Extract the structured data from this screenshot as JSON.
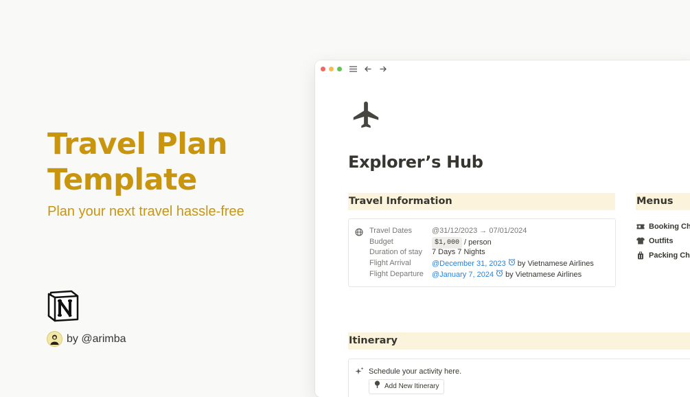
{
  "hero": {
    "title_line1": "Travel Plan",
    "title_line2": "Template",
    "subtitle": "Plan your next travel hassle-free",
    "author": "by @arimba",
    "accent_color": "#c9950c"
  },
  "window": {
    "controls": {
      "close": "#ee6a5f",
      "minimize": "#f5bd4f",
      "maximize": "#61c454"
    },
    "toolbar_icons": [
      "menu-icon",
      "back-arrow-icon",
      "forward-arrow-icon"
    ],
    "page_icon": "airplane-icon",
    "page_title": "Explorer’s Hub"
  },
  "travel_info": {
    "heading": "Travel Information",
    "properties": [
      {
        "label": "Travel Dates",
        "value": "@31/12/2023 → 07/01/2024"
      },
      {
        "label": "Budget",
        "value": "$1,000",
        "suffix": "/ person"
      },
      {
        "label": "Duration of stay",
        "value": "7 Days 7 Nights"
      },
      {
        "label": "Flight Arrival",
        "value": "@December 31, 2023",
        "suffix": "by Vietnamese Airlines"
      },
      {
        "label": "Flight Departure",
        "value": "@January 7, 2024",
        "suffix": "by Vietnamese Airlines"
      }
    ]
  },
  "menus": {
    "heading": "Menus",
    "items": [
      {
        "label": "Booking Che",
        "icon": "ticket-icon"
      },
      {
        "label": "Outfits",
        "icon": "tshirt-icon"
      },
      {
        "label": "Packing Che",
        "icon": "luggage-icon"
      }
    ]
  },
  "itinerary": {
    "heading": "Itinerary",
    "note": "Schedule your activity here.",
    "button_label": "Add New Itinerary"
  }
}
